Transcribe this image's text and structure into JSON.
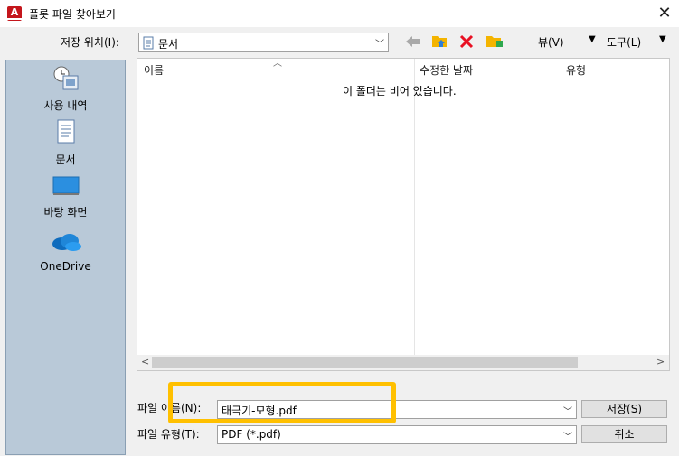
{
  "window": {
    "title": "플롯 파일 찾아보기",
    "app_icon_letter": "A"
  },
  "toolbar": {
    "save_in_label": "저장 위치(I):",
    "save_in_value": "문서",
    "views_label": "뷰(V)",
    "tools_label": "도구(L)"
  },
  "places": [
    {
      "label": "사용 내역",
      "icon": "history-icon"
    },
    {
      "label": "문서",
      "icon": "documents-icon"
    },
    {
      "label": "바탕 화면",
      "icon": "desktop-icon"
    },
    {
      "label": "OneDrive",
      "icon": "onedrive-icon"
    }
  ],
  "filelist": {
    "columns": [
      "이름",
      "수정한 날짜",
      "유형"
    ],
    "empty_message": "이 폴더는 비어 있습니다."
  },
  "footer": {
    "filename_label": "파일 이름(N):",
    "filename_value": "태극기-모형.pdf",
    "filetype_label": "파일 유형(T):",
    "filetype_value": "PDF (*.pdf)",
    "save_button": "저장(S)",
    "cancel_button": "취소"
  },
  "colors": {
    "highlight": "#ffc000",
    "delete": "#e81123",
    "folder": "#f4b400",
    "places_bg": "#b9c9d8"
  }
}
